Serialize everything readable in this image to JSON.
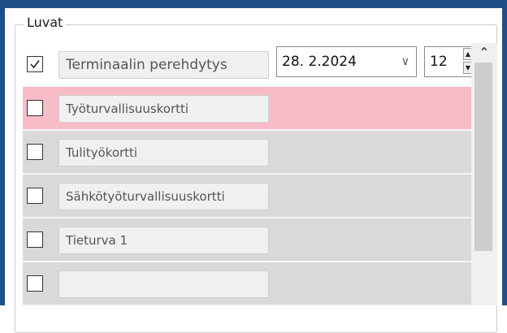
{
  "group": {
    "title": "Luvat"
  },
  "rows": [
    {
      "checked": true,
      "label": "Terminaalin perehdytys",
      "date": "28.  2.2024",
      "number": "12"
    },
    {
      "checked": false,
      "label": "Työturvallisuuskortti"
    },
    {
      "checked": false,
      "label": "Tulityökortti"
    },
    {
      "checked": false,
      "label": "Sähkötyöturvallisuuskortti"
    },
    {
      "checked": false,
      "label": "Tieturva 1"
    },
    {
      "checked": false,
      "label": ""
    }
  ],
  "colors": {
    "frame": "#1e4f86",
    "highlight_row": "#f7bcc8",
    "row_bg": "#d9d9d9"
  }
}
